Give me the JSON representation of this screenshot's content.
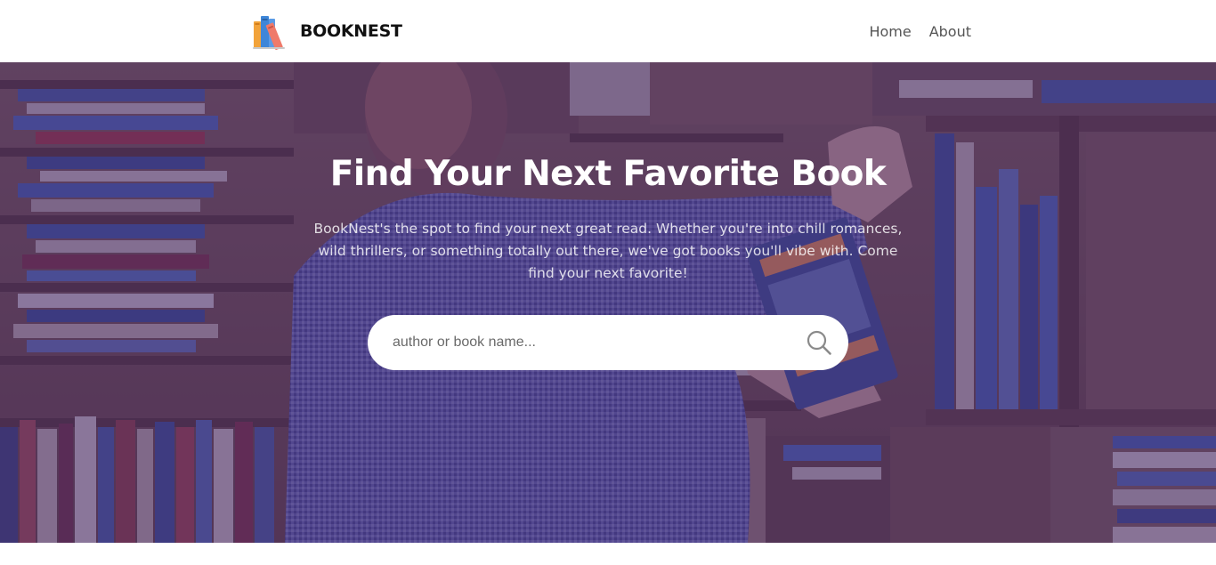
{
  "header": {
    "brand_name": "BOOKNEST",
    "nav": [
      {
        "label": "Home"
      },
      {
        "label": "About"
      }
    ]
  },
  "hero": {
    "title": "Find Your Next Favorite Book",
    "subtitle": "BookNest's the spot to find your next great read. Whether you're into chill romances, wild thrillers, or something totally out there, we've got books you'll vibe with. Come find your next favorite!",
    "overlay_color": "#3e206e",
    "search": {
      "placeholder": "author or book name...",
      "value": "",
      "icon": "search-icon"
    }
  },
  "colors": {
    "header_bg": "#ffffff",
    "brand_text": "#111111",
    "nav_text": "#555555",
    "hero_text": "#ffffff",
    "search_bg": "#ffffff",
    "search_icon": "#8a8a8a"
  }
}
